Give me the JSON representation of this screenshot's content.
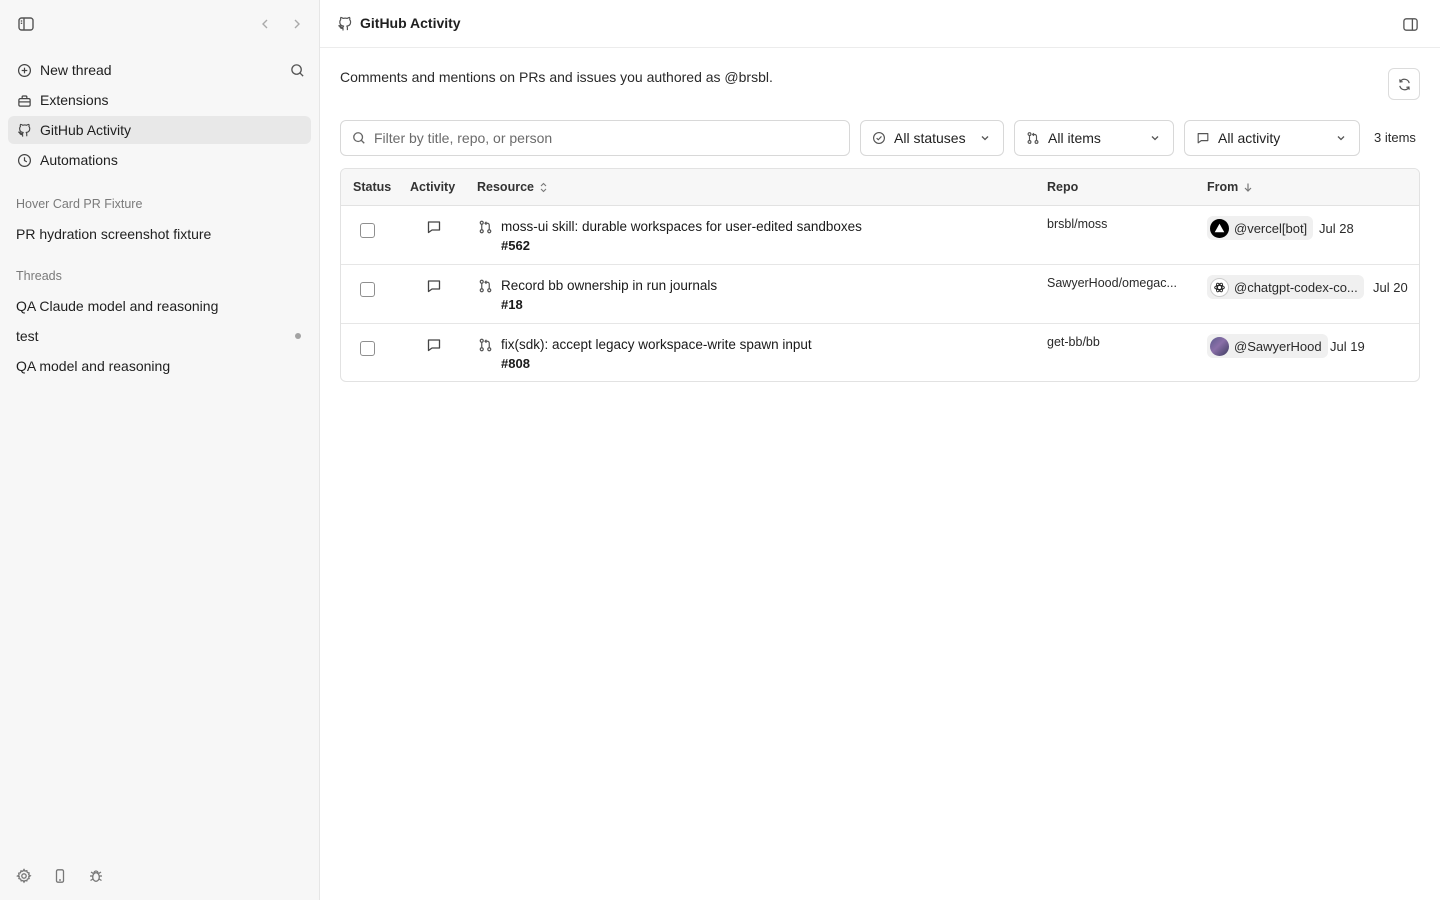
{
  "sidebar": {
    "nav": [
      {
        "label": "New thread",
        "icon": "plus-circle-icon"
      },
      {
        "label": "Extensions",
        "icon": "toolbox-icon"
      },
      {
        "label": "GitHub Activity",
        "icon": "github-icon"
      },
      {
        "label": "Automations",
        "icon": "clock-icon"
      }
    ],
    "active_item": "GitHub Activity",
    "sections": [
      {
        "title": "Hover Card PR Fixture",
        "items": [
          "PR hydration screenshot fixture"
        ]
      },
      {
        "title": "Threads",
        "items": [
          "QA Claude model and reasoning",
          "test",
          "QA model and reasoning"
        ]
      }
    ],
    "unread_dot_on": "test",
    "bottom_icons": [
      "settings-icon",
      "mobile-icon",
      "bug-icon"
    ]
  },
  "header": {
    "title": "GitHub Activity",
    "icon": "github-icon"
  },
  "description": "Comments and mentions on PRs and issues you authored as @brsbl.",
  "filters": {
    "search_placeholder": "Filter by title, repo, or person",
    "status": "All statuses",
    "items": "All items",
    "activity": "All activity",
    "count": "3 items"
  },
  "table": {
    "columns": [
      "Status",
      "Activity",
      "Resource",
      "Repo",
      "From"
    ],
    "rows": [
      {
        "title": "moss-ui skill: durable workspaces for user-edited sandboxes",
        "number": "#562",
        "repo": "brsbl/moss",
        "from": "@vercel[bot]",
        "avatar": "vercel-avatar",
        "date": "Jul 28"
      },
      {
        "title": "Record bb ownership in run journals",
        "number": "#18",
        "repo": "SawyerHood/omegac...",
        "from": "@chatgpt-codex-co...",
        "avatar": "openai-avatar",
        "date": "Jul 20"
      },
      {
        "title": "fix(sdk): accept legacy workspace-write spawn input",
        "number": "#808",
        "repo": "get-bb/bb",
        "from": "@SawyerHood",
        "avatar": "user-photo-avatar",
        "date": "Jul 19"
      }
    ]
  },
  "colors": {
    "sidebar_bg": "#f7f7f7",
    "active_bg": "#e8e8e8",
    "border": "#e2e2e2",
    "pill_bg": "#f0f0f0"
  }
}
